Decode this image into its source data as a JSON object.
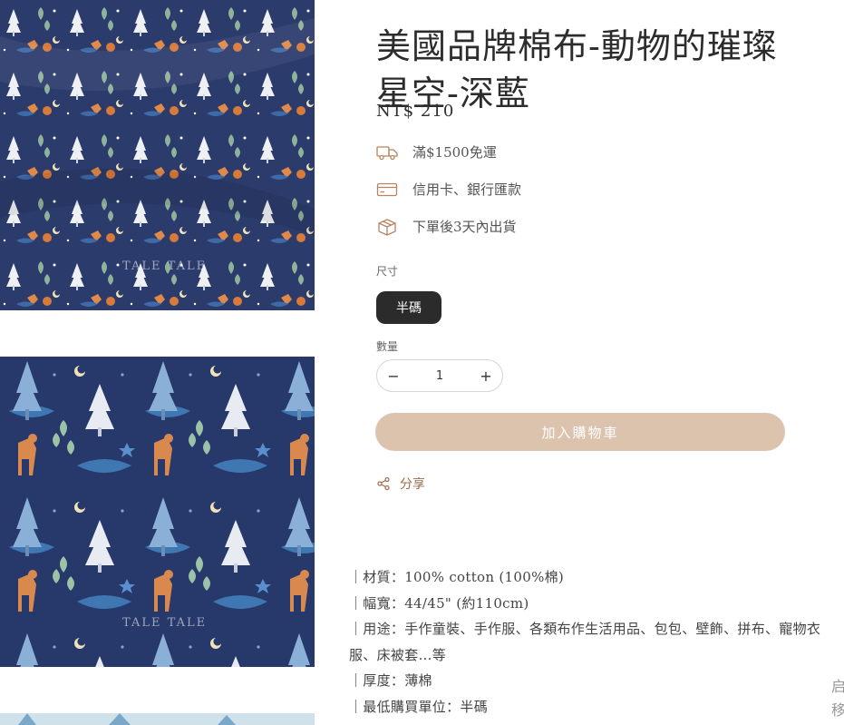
{
  "product": {
    "title_line1": "美國品牌棉布-動物的璀璨",
    "title_line2": "星空-深藍",
    "price": "NT$ 210"
  },
  "info": [
    {
      "icon": "truck-icon",
      "text": "滿$1500免運"
    },
    {
      "icon": "credit-card-icon",
      "text": "信用卡、銀行匯款"
    },
    {
      "icon": "package-box-icon",
      "text": "下單後3天內出貨"
    }
  ],
  "size": {
    "label": "尺寸",
    "selected": "半碼"
  },
  "quantity": {
    "label": "數量",
    "value": "1",
    "minus": "−",
    "plus": "+"
  },
  "cart_button": "加入購物車",
  "share": {
    "label": "分享",
    "icon": "share-icon"
  },
  "description": [
    "｜材質：100% cotton (100%棉)",
    "｜幅寬：44/45\" (約110cm)",
    "｜用途：手作童裝、手作服、各類布作生活用品、包包、壁飾、拼布、寵物衣服、床被套…等",
    "｜厚度：薄棉",
    "｜最低購買單位：半碼"
  ],
  "watermark": "TALE TALE",
  "side_tag": [
    "启",
    "移"
  ],
  "colors": {
    "fabric_navy": "#2a3a6b",
    "cart_button": "#dcc3ae",
    "size_button": "#2b2b2b",
    "share_accent": "#9b6c4e"
  }
}
